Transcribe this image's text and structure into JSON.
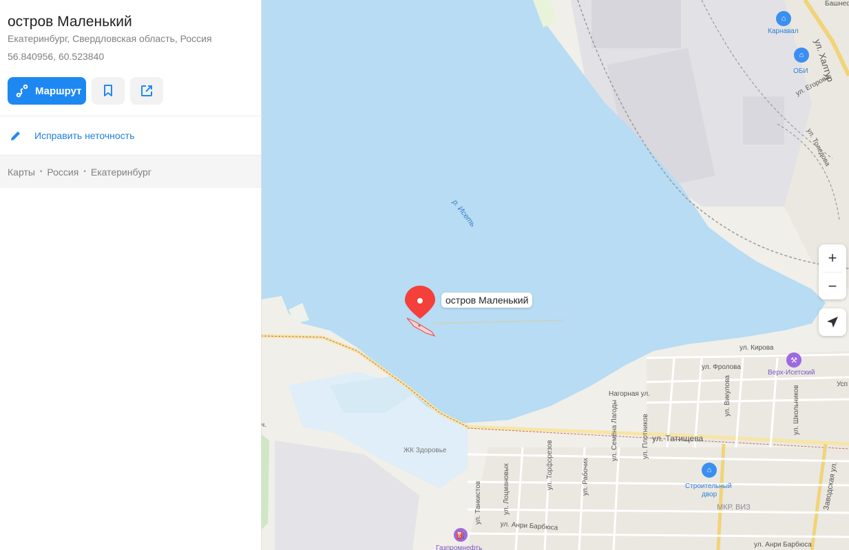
{
  "place": {
    "title": "остров Маленький",
    "address": "Екатеринбург, Свердловская область, Россия",
    "coordinates": "56.840956, 60.523840"
  },
  "actions": {
    "route_label": "Маршрут",
    "bookmark_icon": "bookmark-icon",
    "share_icon": "share-icon"
  },
  "fix": {
    "label": "Исправить неточность",
    "icon": "pencil-icon"
  },
  "breadcrumbs": [
    "Карты",
    "Россия",
    "Екатеринбург"
  ],
  "map": {
    "pin_label": "остров Маленький",
    "river_label": "р. Исеть",
    "streets": {
      "khaltur": "ул. Халтур",
      "egorova": "ул. Егорова",
      "toleдova": "ул. Толедова",
      "kirova": "ул. Кирова",
      "frolova": "ул. Фролова",
      "nagornaya": "Нагорная ул.",
      "vikulova": "ул. Викулова",
      "shkolnikov": "ул. Школьников",
      "tatishcheva": "ул. Татищева",
      "zavodskaya": "Заводская ул.",
      "lagody": "ул. Семёна Лагоды",
      "plotnikov": "ул. Плотников",
      "rabochikh": "ул. Рабочих",
      "torforezov": "ул. Торфорезов",
      "lotsmanovykh": "ул. Лоцмановых",
      "tankistov": "ул. Танкистов",
      "anri1": "ул. Анри Барбюса",
      "anri2": "ул. Анри Барбюса",
      "ch": "ч."
    },
    "pois": {
      "karnaval": "Карнавал",
      "obi": "ОБИ",
      "bashneft": "Башнеф",
      "verkh_isetsky": "Верх-Исетский",
      "stroitelny_dvor_1": "Строительный",
      "stroitelny_dvor_2": "двор",
      "mkr_viz": "МКР. ВИЗ",
      "zk_zdorovye": "ЖК Здоровье",
      "gazpromneft": "Газпромнефть",
      "usp": "Усп"
    }
  },
  "controls": {
    "zoom_in": "+",
    "zoom_out": "−",
    "locate_icon": "locate-arrow-icon"
  },
  "colors": {
    "accent": "#1e88f2",
    "water": "#b7dcf3",
    "pin": "#f43f3a"
  }
}
